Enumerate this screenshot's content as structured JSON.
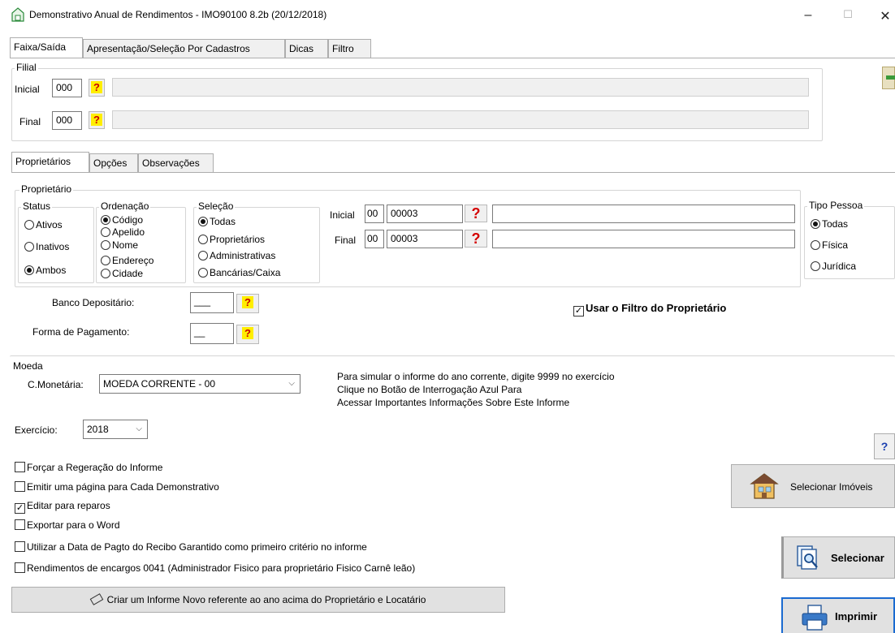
{
  "window": {
    "title": "Demonstrativo Anual de Rendimentos - IMO90100 8.2b (20/12/2018)",
    "minimize": "–",
    "maximize": "☐",
    "close": "✕"
  },
  "top_tabs": [
    "Faixa/Saída",
    "Apresentação/Seleção Por Cadastros",
    "Dicas",
    "Filtro"
  ],
  "filial": {
    "label": "Filial",
    "inicial_label": "Inicial",
    "inicial_value": "000",
    "final_label": "Final",
    "final_value": "000"
  },
  "inner_tabs": [
    "Proprietários",
    "Opções",
    "Observações"
  ],
  "proprietario": {
    "label": "Proprietário",
    "status": {
      "label": "Status",
      "options": [
        "Ativos",
        "Inativos",
        "Ambos"
      ],
      "selected": 2
    },
    "ordenacao": {
      "label": "Ordenação",
      "options": [
        "Código",
        "Apelido",
        "Nome",
        "Endereço",
        "Cidade"
      ],
      "selected": 0
    },
    "selecao": {
      "label": "Seleção",
      "options": [
        "Todas",
        "Proprietários",
        "Administrativas",
        "Bancárias/Caixa"
      ],
      "selected": 0
    },
    "inicial_label": "Inicial",
    "inicial_prefix": "00",
    "inicial_value": "00003",
    "final_label": "Final",
    "final_prefix": "00",
    "final_value": "00003"
  },
  "tipo_pessoa": {
    "label": "Tipo Pessoa",
    "options": [
      "Todas",
      "Física",
      "Jurídica"
    ],
    "selected": 0
  },
  "banco_label": "Banco Depositário:",
  "banco_value": "___",
  "forma_label": "Forma de Pagamento:",
  "forma_value": "__",
  "usar_filtro": "Usar o Filtro do Proprietário",
  "moeda": {
    "label": "Moeda",
    "cmonetaria_label": "C.Monetária:",
    "cmonetaria_value": "MOEDA CORRENTE - 00"
  },
  "info_lines": [
    "Para simular o informe do ano corrente, digite 9999 no exercício",
    "Clique no Botão de Interrogação Azul Para",
    "Acessar Importantes Informações Sobre Este Informe"
  ],
  "exercicio_label": "Exercício:",
  "exercicio_value": "2018",
  "checks": [
    {
      "label": "Forçar a Regeração do Informe",
      "checked": false
    },
    {
      "label": "Emitir uma página para Cada Demonstrativo",
      "checked": false
    },
    {
      "label": "Editar para reparos",
      "checked": true
    },
    {
      "label": "Exportar para o Word",
      "checked": false
    },
    {
      "label": "Utilizar a Data de Pagto do Recibo Garantido como primeiro critério no informe",
      "checked": false
    },
    {
      "label": "Rendimentos de encargos 0041 (Administrador Fisico para proprietário Fisico Carnê leão)",
      "checked": false
    }
  ],
  "criar_button": "Criar um Informe Novo referente ao ano acima do Proprietário e Locatário",
  "help_button": "?",
  "selecionar_imoveis": "Selecionar Imóveis",
  "selecionar": "Selecionar",
  "imprimir": "Imprimir",
  "question_mark": "?"
}
